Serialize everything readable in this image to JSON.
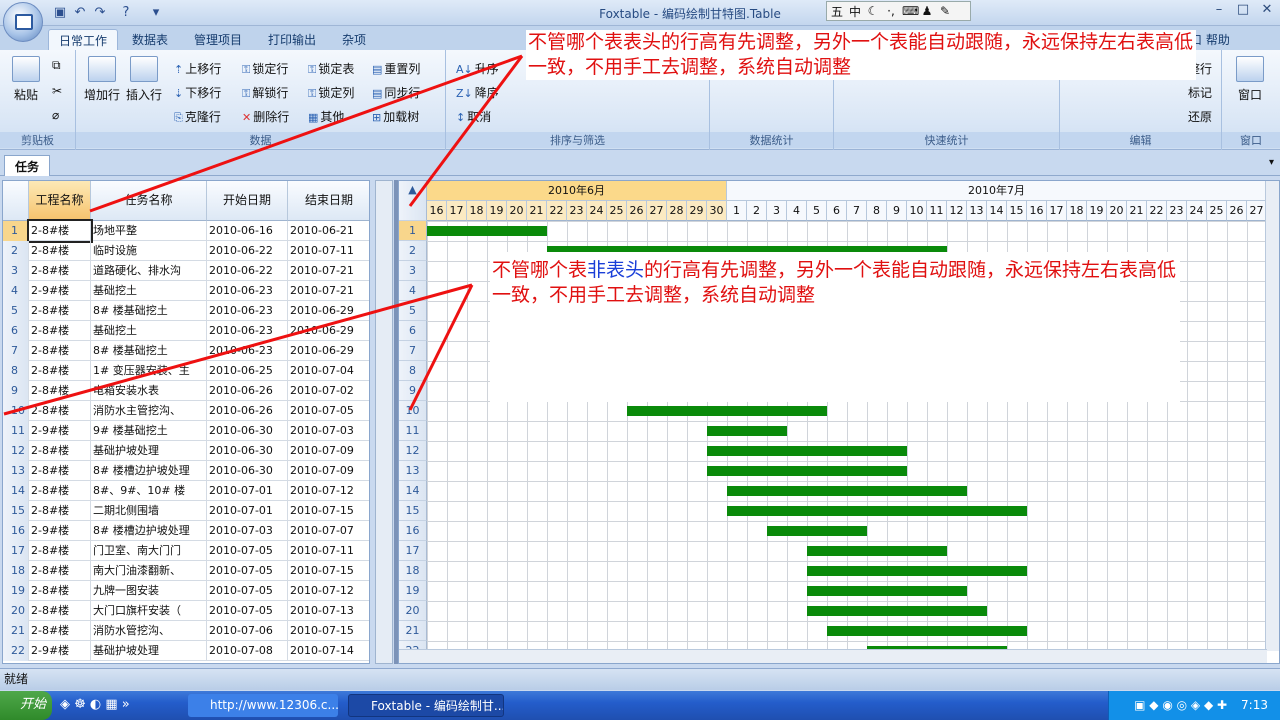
{
  "window": {
    "title": "Foxtable - 编码绘制甘特图.Table"
  },
  "ribbon_tabs": [
    "日常工作",
    "数据表",
    "管理项目",
    "打印输出",
    "杂项"
  ],
  "help_label": "帮助",
  "groups": {
    "clipboard": {
      "label": "剪贴板",
      "paste": "粘贴"
    },
    "data": {
      "label": "数据",
      "add_row": "增加行",
      "insert_row": "插入行",
      "buttons": [
        "上移行",
        "下移行",
        "克隆行",
        "锁定行",
        "解锁行",
        "删除行",
        "锁定表",
        "锁定列",
        "其他",
        "重置列",
        "同步行",
        "加载树"
      ]
    },
    "sort": {
      "label": "排序与筛选",
      "buttons": [
        "升序",
        "降序",
        "取消"
      ]
    },
    "stats": {
      "label": "数据统计"
    },
    "quickstats": {
      "label": "快速统计"
    },
    "edit": {
      "label": "编辑",
      "buttons": [
        "整行",
        "标记",
        "还原"
      ]
    },
    "window": {
      "label": "窗口",
      "button": "窗口"
    }
  },
  "sheet_tab": "任务",
  "left_table": {
    "headers": [
      "工程名称",
      "任务名称",
      "开始日期",
      "结束日期"
    ],
    "rows": [
      [
        "1",
        "2-8#楼",
        "场地平整",
        "2010-06-16",
        "2010-06-21"
      ],
      [
        "2",
        "2-8#楼",
        "临时设施",
        "2010-06-22",
        "2010-07-11"
      ],
      [
        "3",
        "2-8#楼",
        "道路硬化、排水沟",
        "2010-06-22",
        "2010-07-21"
      ],
      [
        "4",
        "2-9#楼",
        "基础挖土",
        "2010-06-23",
        "2010-07-21"
      ],
      [
        "5",
        "2-8#楼",
        "8# 楼基础挖土",
        "2010-06-23",
        "2010-06-29"
      ],
      [
        "6",
        "2-8#楼",
        "基础挖土",
        "2010-06-23",
        "2010-06-29"
      ],
      [
        "7",
        "2-8#楼",
        "8# 楼基础挖土",
        "2010-06-23",
        "2010-06-29"
      ],
      [
        "8",
        "2-8#楼",
        "1# 变压器安装、主",
        "2010-06-25",
        "2010-07-04"
      ],
      [
        "9",
        "2-8#楼",
        "电箱安装水表",
        "2010-06-26",
        "2010-07-02"
      ],
      [
        "10",
        "2-8#楼",
        "消防水主管挖沟、",
        "2010-06-26",
        "2010-07-05"
      ],
      [
        "11",
        "2-9#楼",
        "9# 楼基础挖土",
        "2010-06-30",
        "2010-07-03"
      ],
      [
        "12",
        "2-8#楼",
        "基础护坡处理",
        "2010-06-30",
        "2010-07-09"
      ],
      [
        "13",
        "2-8#楼",
        "8# 楼槽边护坡处理",
        "2010-06-30",
        "2010-07-09"
      ],
      [
        "14",
        "2-8#楼",
        "8#、9#、10# 楼",
        "2010-07-01",
        "2010-07-12"
      ],
      [
        "15",
        "2-8#楼",
        "二期北侧围墙",
        "2010-07-01",
        "2010-07-15"
      ],
      [
        "16",
        "2-9#楼",
        "8# 楼槽边护坡处理",
        "2010-07-03",
        "2010-07-07"
      ],
      [
        "17",
        "2-8#楼",
        "门卫室、南大门门",
        "2010-07-05",
        "2010-07-11"
      ],
      [
        "18",
        "2-8#楼",
        "南大门油漆翻新、",
        "2010-07-05",
        "2010-07-15"
      ],
      [
        "19",
        "2-8#楼",
        "九牌一图安装",
        "2010-07-05",
        "2010-07-12"
      ],
      [
        "20",
        "2-8#楼",
        "大门口旗杆安装（",
        "2010-07-05",
        "2010-07-13"
      ],
      [
        "21",
        "2-8#楼",
        "消防水管挖沟、",
        "2010-07-06",
        "2010-07-15"
      ],
      [
        "22",
        "2-9#楼",
        "基础护坡处理",
        "2010-07-08",
        "2010-07-14"
      ]
    ]
  },
  "gantt": {
    "months": [
      "2010年6月",
      "2010年7月"
    ],
    "days": [
      "16",
      "17",
      "18",
      "19",
      "20",
      "21",
      "22",
      "23",
      "24",
      "25",
      "26",
      "27",
      "28",
      "29",
      "30",
      "1",
      "2",
      "3",
      "4",
      "5",
      "6",
      "7",
      "8",
      "9",
      "10",
      "11",
      "12",
      "13",
      "14",
      "15",
      "16",
      "17",
      "18",
      "19",
      "20",
      "21",
      "22",
      "23",
      "24",
      "25",
      "26",
      "27"
    ],
    "row_numbers": [
      "1",
      "2",
      "3",
      "4",
      "5",
      "6",
      "7",
      "8",
      "9",
      "10",
      "11",
      "12",
      "13",
      "14",
      "15",
      "16",
      "17",
      "18",
      "19",
      "20",
      "21",
      "22"
    ],
    "bar_color": "#0a8a0a",
    "bars": [
      [
        0,
        6
      ],
      [
        6,
        26
      ],
      null,
      null,
      null,
      null,
      null,
      null,
      null,
      [
        10,
        20
      ],
      [
        14,
        18
      ],
      [
        14,
        24
      ],
      [
        14,
        24
      ],
      [
        15,
        27
      ],
      [
        15,
        30
      ],
      [
        17,
        22
      ],
      [
        19,
        26
      ],
      [
        19,
        30
      ],
      [
        19,
        27
      ],
      [
        19,
        28
      ],
      [
        20,
        30
      ],
      [
        22,
        29
      ]
    ]
  },
  "annotations": {
    "note1": "不管哪个表表头的行高有先调整，另外一个表能自动跟随，永远保持左右表高低一致，不用手工去调整，系统自动调整",
    "note2_before": "不管哪个表",
    "note2_highlight": "非表头",
    "note2_after": "的行高有先调整，另外一个表能自动跟随，永远保持左右表高低一致，不用手工去调整，系统自动调整",
    "line_color": "#ee1111"
  },
  "status": "就绪",
  "taskbar": {
    "start": "开始",
    "tasks": [
      "http://www.12306.c...",
      "Foxtable - 编码绘制甘..."
    ],
    "clock": "7:13"
  }
}
